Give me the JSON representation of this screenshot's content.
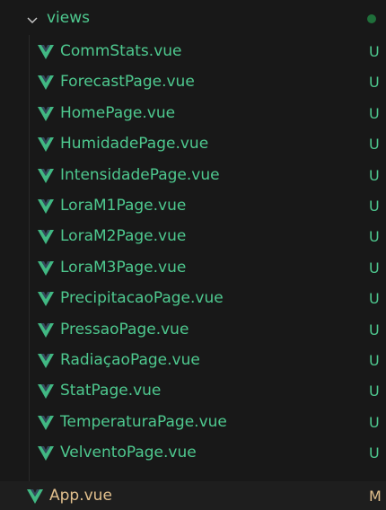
{
  "folder": {
    "name": "views",
    "chevron_icon": "chevron-down-icon"
  },
  "colors": {
    "untracked": "#4ec98f",
    "modified": "#e2c08d",
    "vue_icon": "#41b883",
    "folder_dot": "#1f6f3a",
    "background": "#181818"
  },
  "files": [
    {
      "name": "CommStats.vue",
      "status": "U"
    },
    {
      "name": "ForecastPage.vue",
      "status": "U"
    },
    {
      "name": "HomePage.vue",
      "status": "U"
    },
    {
      "name": "HumidadePage.vue",
      "status": "U"
    },
    {
      "name": "IntensidadePage.vue",
      "status": "U"
    },
    {
      "name": "LoraM1Page.vue",
      "status": "U"
    },
    {
      "name": "LoraM2Page.vue",
      "status": "U"
    },
    {
      "name": "LoraM3Page.vue",
      "status": "U"
    },
    {
      "name": "PrecipitacaoPage.vue",
      "status": "U"
    },
    {
      "name": "PressaoPage.vue",
      "status": "U"
    },
    {
      "name": "RadiaçaoPage.vue",
      "status": "U"
    },
    {
      "name": "StatPage.vue",
      "status": "U"
    },
    {
      "name": "TemperaturaPage.vue",
      "status": "U"
    },
    {
      "name": "VelventoPage.vue",
      "status": "U"
    }
  ],
  "root_file": {
    "name": "App.vue",
    "status": "M"
  }
}
